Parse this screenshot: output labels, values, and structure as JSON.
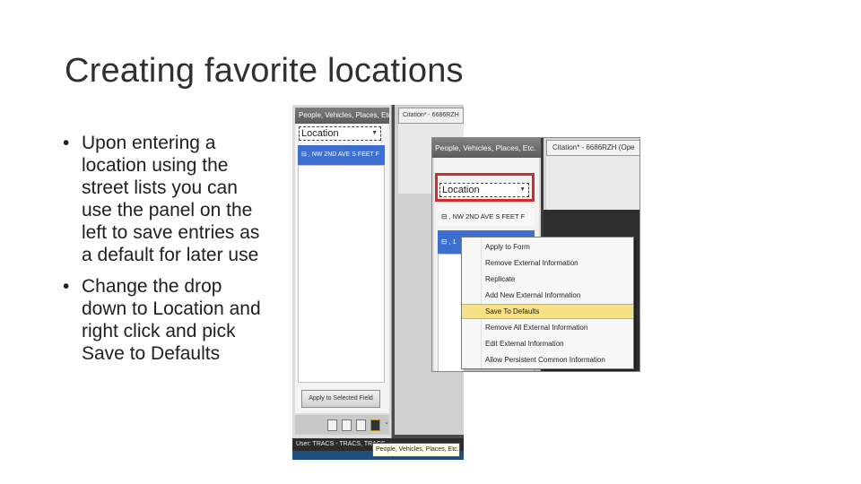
{
  "slide": {
    "title": "Creating favorite locations",
    "bullets": [
      "Upon entering a location using the street lists you can use the panel on the left to save entries as a default for later use",
      "Change the drop down to Location and right click and pick Save to Defaults"
    ],
    "bullet_char": "•"
  },
  "screenshot_back": {
    "panel_title": "People, Vehicles, Places, Etc.",
    "citation_tab": "Citation* - 6686RZH",
    "dropdown_value": "Location",
    "selected_row": ", NW 2ND AVE S FEET F",
    "apply_button": "Apply to Selected Field",
    "status_bar": "User: TRACS - TRACS, TRACS",
    "tooltip": "People, Vehicles, Places, Etc.",
    "toolbar_icons": [
      "new-document-icon",
      "copy-icon",
      "edit-icon",
      "favorites-icon",
      "chevron-down-icon"
    ]
  },
  "screenshot_front": {
    "panel_title": "People, Vehicles, Places, Etc.",
    "citation_tab": "Citation* - 6686RZH (Ope",
    "dropdown_value": "Location",
    "row1": ", NW 2ND AVE S FEET F",
    "row2": ", 1",
    "highlight_color": "#d42a2a"
  },
  "context_menu": {
    "items": [
      "Apply to Form",
      "Remove External Information",
      "Replicate",
      "Add New External Information",
      "Save To Defaults",
      "Remove All External Information",
      "Edit External Information",
      "Allow Persistent Common Information"
    ],
    "selected_index": 4,
    "selected_color": "#f6e184"
  },
  "colors": {
    "row_selected": "#3d6fd0",
    "title_text": "#303030"
  }
}
